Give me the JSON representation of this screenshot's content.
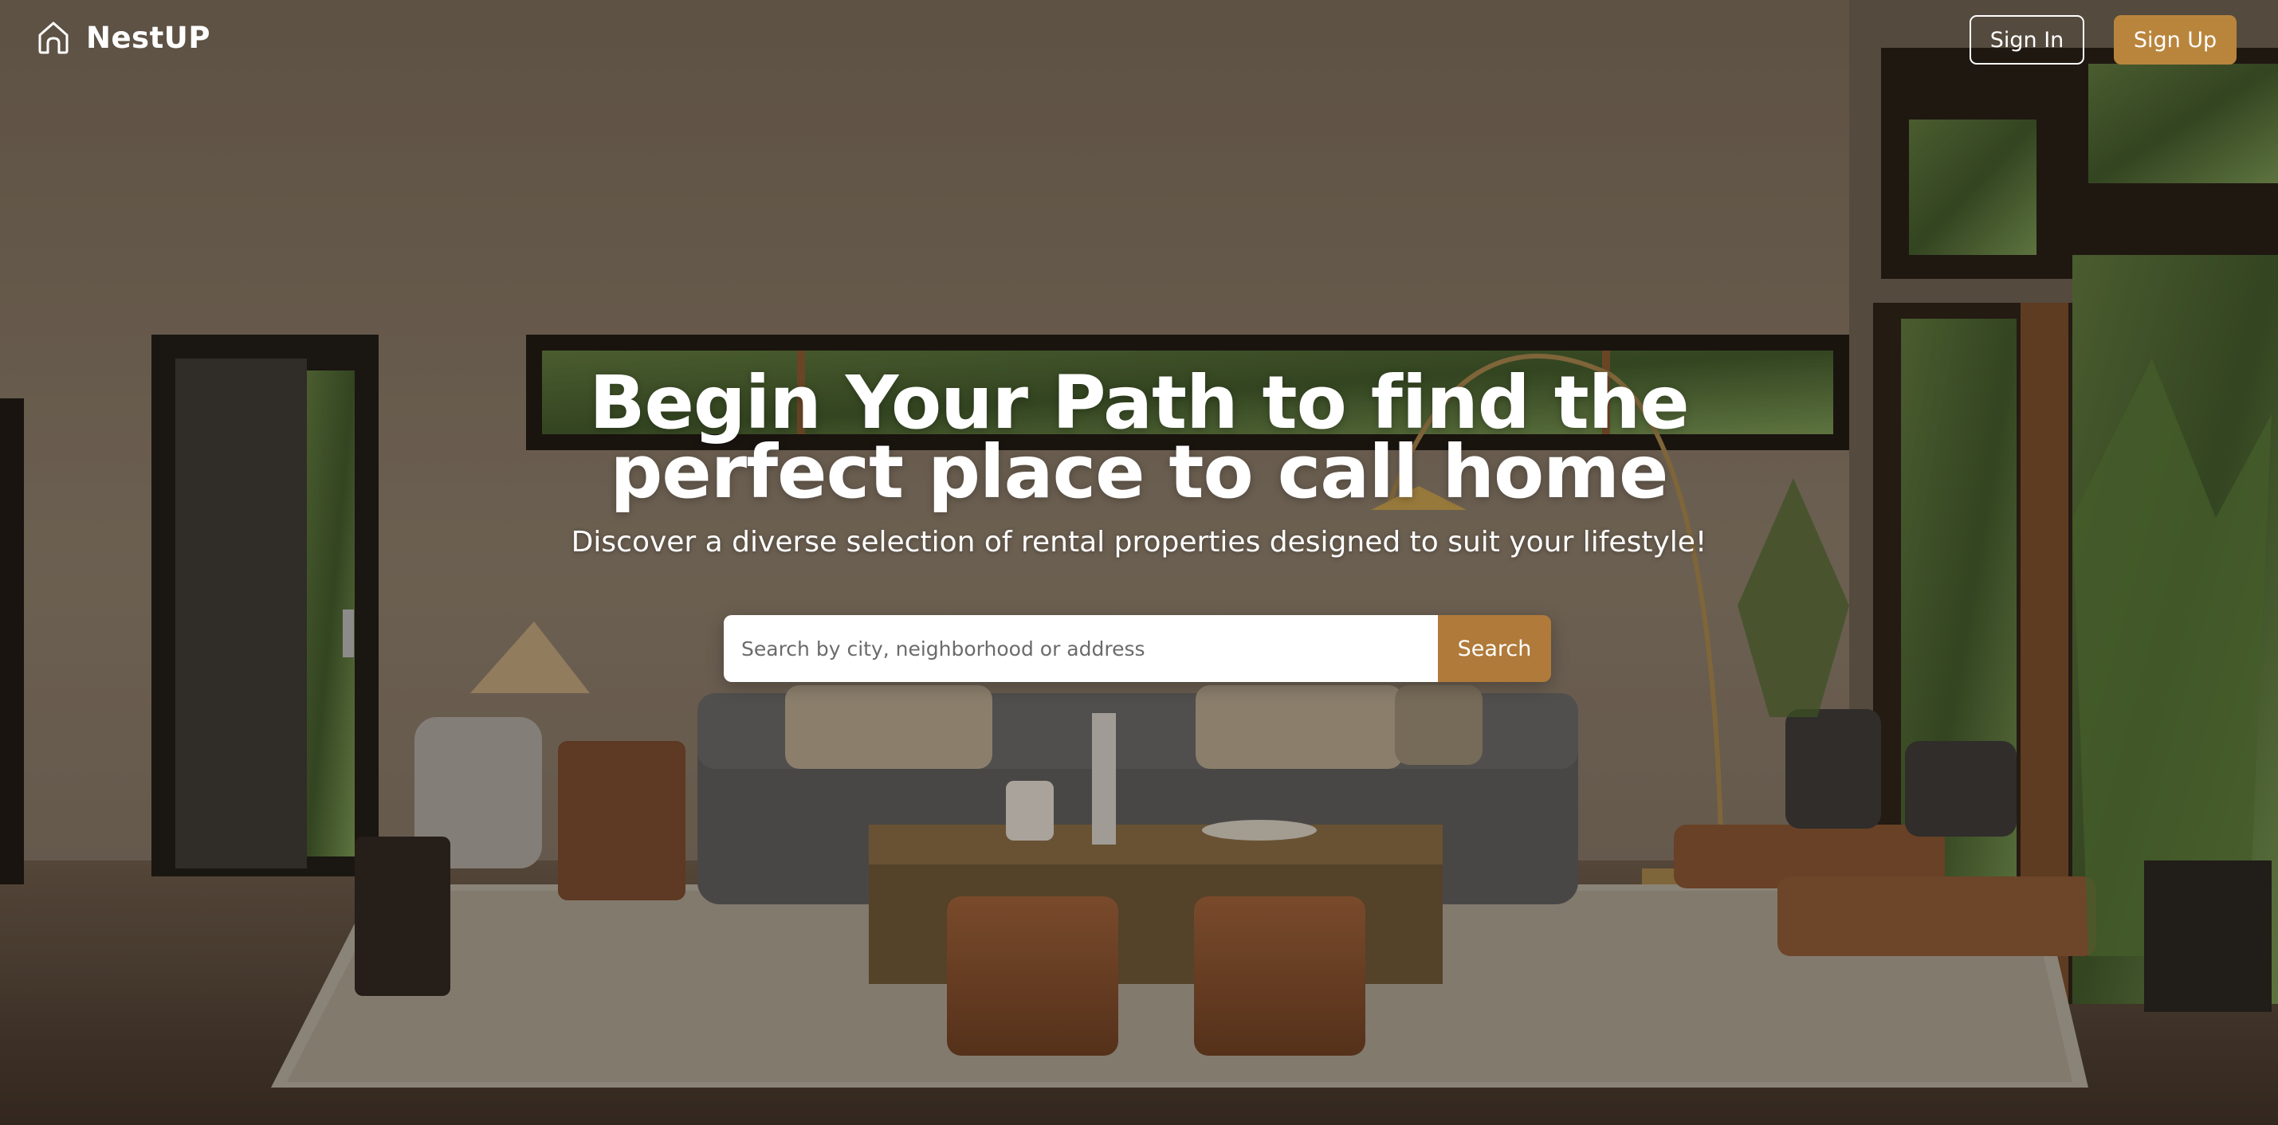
{
  "brand": {
    "name": "NestUP",
    "icon": "house-icon"
  },
  "nav": {
    "signin_label": "Sign In",
    "signup_label": "Sign Up"
  },
  "hero": {
    "headline_line1": "Begin Your Path to find the",
    "headline_line2": "perfect place to call home",
    "subheadline": "Discover a diverse selection of rental properties designed to suit your lifestyle!"
  },
  "search": {
    "placeholder": "Search by city, neighborhood or address",
    "value": "",
    "button_label": "Search"
  },
  "colors": {
    "accent": "#b9853d",
    "search_button": "#b07a3a",
    "text": "#ffffff"
  }
}
